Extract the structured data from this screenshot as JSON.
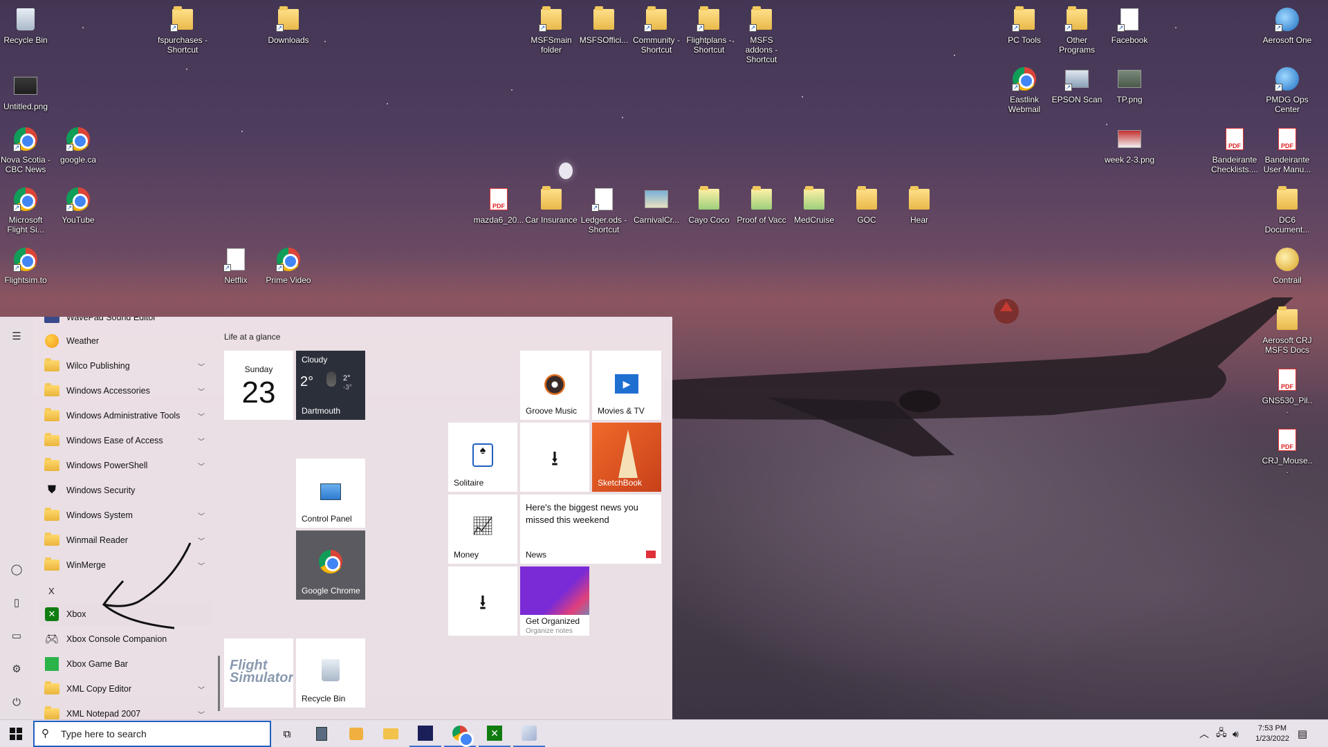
{
  "desktop": {
    "icons": [
      {
        "label": "Recycle Bin"
      },
      {
        "label": "fspurchases - Shortcut"
      },
      {
        "label": "Downloads"
      },
      {
        "label": "MSFSmain folder"
      },
      {
        "label": "MSFSOffici..."
      },
      {
        "label": "Community - Shortcut"
      },
      {
        "label": "Flightplans - Shortcut"
      },
      {
        "label": "MSFS addons - Shortcut"
      },
      {
        "label": "PC Tools"
      },
      {
        "label": "Other Programs"
      },
      {
        "label": "Facebook"
      },
      {
        "label": "Aerosoft One"
      },
      {
        "label": "Untitled.png"
      },
      {
        "label": "Eastlink Webmail"
      },
      {
        "label": "EPSON Scan"
      },
      {
        "label": "TP.png"
      },
      {
        "label": "PMDG Ops Center"
      },
      {
        "label": "Nova Scotia - CBC News"
      },
      {
        "label": "google.ca"
      },
      {
        "label": "week 2-3.png"
      },
      {
        "label": "Bandeirante Checklists...."
      },
      {
        "label": "Bandeirante User Manu..."
      },
      {
        "label": "Microsoft Flight Si..."
      },
      {
        "label": "YouTube"
      },
      {
        "label": "mazda6_20..."
      },
      {
        "label": "Car Insurance"
      },
      {
        "label": "Ledger.ods - Shortcut"
      },
      {
        "label": "CarnivalCr..."
      },
      {
        "label": "Cayo Coco"
      },
      {
        "label": "Proof of Vacc"
      },
      {
        "label": "MedCruise"
      },
      {
        "label": "GOC"
      },
      {
        "label": "Hear"
      },
      {
        "label": "DC6 Document..."
      },
      {
        "label": "Flightsim.to"
      },
      {
        "label": "Netflix"
      },
      {
        "label": "Prime Video"
      },
      {
        "label": "Contrail"
      },
      {
        "label": "Aerosoft CRJ MSFS Docs"
      },
      {
        "label": "GNS530_Pil..."
      },
      {
        "label": "CRJ_Mouse..."
      }
    ]
  },
  "start_menu": {
    "apps": [
      {
        "label": "WavePad Sound Editor",
        "icon": "wavepad-icon"
      },
      {
        "label": "Weather",
        "icon": "weather-icon"
      },
      {
        "label": "Wilco Publishing",
        "icon": "folder-icon",
        "expand": true
      },
      {
        "label": "Windows Accessories",
        "icon": "folder-icon",
        "expand": true
      },
      {
        "label": "Windows Administrative Tools",
        "icon": "folder-icon",
        "expand": true
      },
      {
        "label": "Windows Ease of Access",
        "icon": "folder-icon",
        "expand": true
      },
      {
        "label": "Windows PowerShell",
        "icon": "folder-icon",
        "expand": true
      },
      {
        "label": "Windows Security",
        "icon": "shield-icon"
      },
      {
        "label": "Windows System",
        "icon": "folder-icon",
        "expand": true
      },
      {
        "label": "Winmail Reader",
        "icon": "folder-icon",
        "expand": true
      },
      {
        "label": "WinMerge",
        "icon": "folder-icon",
        "expand": true
      }
    ],
    "letter_x": "X",
    "apps_x": [
      {
        "label": "Xbox",
        "icon": "xbox-icon",
        "selected": true
      },
      {
        "label": "Xbox Console Companion",
        "icon": "controller-icon"
      },
      {
        "label": "Xbox Game Bar",
        "icon": "gamebar-icon"
      },
      {
        "label": "XML Copy Editor",
        "icon": "folder-icon",
        "expand": true
      },
      {
        "label": "XML Notepad 2007",
        "icon": "folder-icon",
        "expand": true
      }
    ],
    "group_title": "Life at a glance",
    "calendar": {
      "day": "Sunday",
      "date": "23"
    },
    "weather": {
      "condition": "Cloudy",
      "temp": "2°",
      "high": "2°",
      "low": "-3°",
      "city": "Dartmouth"
    },
    "tiles": {
      "groove": "Groove Music",
      "movies": "Movies & TV",
      "solitaire": "Solitaire",
      "sketchbook": "SketchBook",
      "control_panel": "Control Panel",
      "money": "Money",
      "news_headline": "Here's the biggest news you missed this weekend",
      "news": "News",
      "chrome": "Google Chrome",
      "onenote": "Get Organized",
      "onenote_sub": "Organize notes",
      "recycle": "Recycle Bin"
    }
  },
  "taskbar": {
    "search_placeholder": "Type here to search",
    "time": "7:53 PM",
    "date": "1/23/2022"
  },
  "colors": {
    "accent": "#1f5fbf",
    "tile_dark": "#2a2f3a",
    "sketch": "#e05a2a"
  }
}
